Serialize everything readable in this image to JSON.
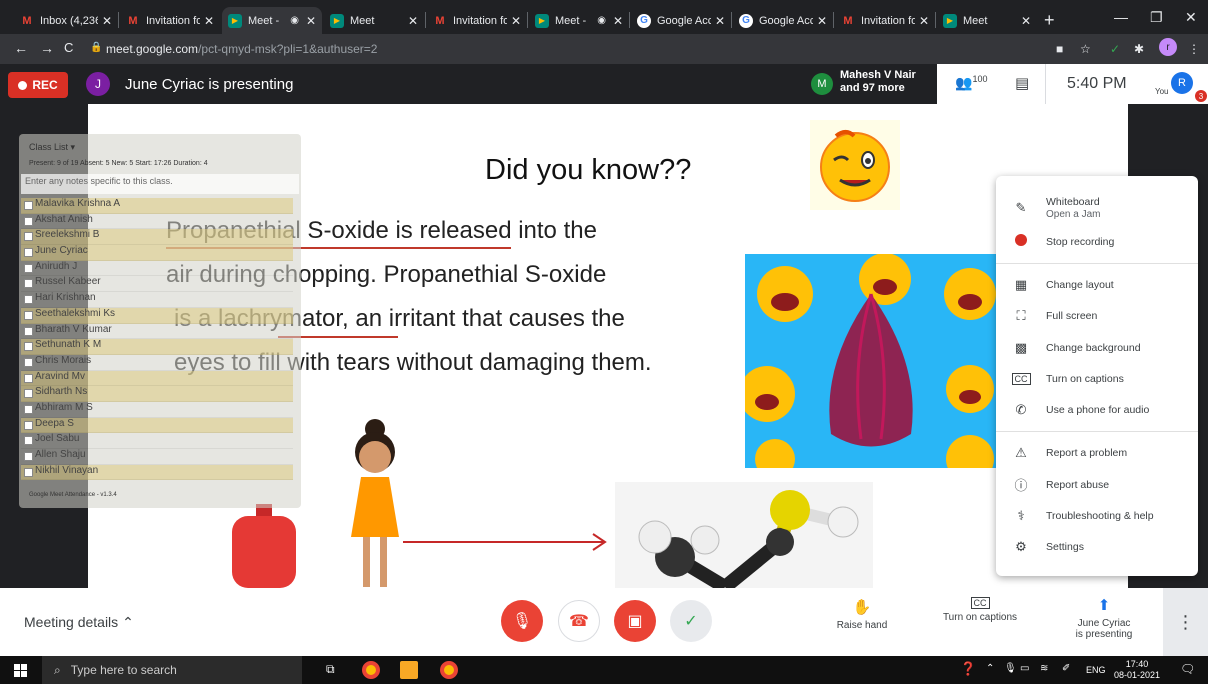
{
  "browser": {
    "tabs": [
      {
        "title": "Inbox (4,236",
        "icon": "gmail-icon",
        "active": false
      },
      {
        "title": "Invitation fo",
        "icon": "gmail-icon",
        "active": false
      },
      {
        "title": "Meet - ",
        "icon": "meet-icon",
        "active": true
      },
      {
        "title": "Meet",
        "icon": "meet-icon",
        "active": false
      },
      {
        "title": "Invitation fo",
        "icon": "gmail-icon",
        "active": false
      },
      {
        "title": "Meet - ",
        "icon": "meet-icon",
        "active": false
      },
      {
        "title": "Google Acco",
        "icon": "google-icon",
        "active": false
      },
      {
        "title": "Google Acco",
        "icon": "google-icon",
        "active": false
      },
      {
        "title": "Invitation fo",
        "icon": "gmail-icon",
        "active": false
      },
      {
        "title": "Meet",
        "icon": "meet-icon",
        "active": false
      }
    ],
    "url_host": "meet.google.com",
    "url_path": "/pct-qmyd-msk?pli=1&authuser=2",
    "profile_initial": "r"
  },
  "meet": {
    "rec_label": "REC",
    "presenter_initial": "J",
    "presenter_text": "June Cyriac is presenting",
    "speaker_initial": "M",
    "speaker_line1": "Mahesh V Nair",
    "speaker_line2": "and 97 more",
    "people_count": "100",
    "time": "5:40 PM",
    "you_label": "You",
    "user_initial": "R",
    "notification_count": "3"
  },
  "slide": {
    "title": "Did you know??",
    "lines": [
      "Propanethial S-oxide is released into the",
      "air during chopping. Propanethial S-oxide",
      "is a lachrymator, an irritant that causes the",
      "eyes to fill with tears without damaging them."
    ]
  },
  "attendance": {
    "title": "Class List",
    "stats": "Present: 9 of 19   Absent: 5   New: 5   Start: 17:26   Duration: 4",
    "note_placeholder": "Enter any notes specific to this class.",
    "students": [
      "Malavika Krishna A",
      "Akshat Anish",
      "Sreelekshmi B",
      "June Cyriac",
      "Anirudh J",
      "Russel Kabeer",
      "Hari Krishnan",
      "Seethalekshmi Ks",
      "Bharath V Kumar",
      "Sethunath K M",
      "Chris Morais",
      "Aravind Mv",
      "Sidharth Ns",
      "Abhiram M S",
      "Deepa S",
      "Joel Sabu",
      "Allen Shaju",
      "Nikhil Vinayan"
    ],
    "highlighted": [
      0,
      2,
      3,
      7,
      9,
      11,
      12,
      14,
      17
    ],
    "footer": "Google Meet Attendance - v1.3.4"
  },
  "menu": {
    "items": [
      {
        "label": "Whiteboard",
        "sub": "Open a Jam",
        "icon": "pen-icon"
      },
      {
        "label": "Stop recording",
        "icon": "record-icon"
      },
      {
        "label": "Change layout",
        "icon": "layout-icon"
      },
      {
        "label": "Full screen",
        "icon": "fullscreen-icon"
      },
      {
        "label": "Change background",
        "icon": "background-icon"
      },
      {
        "label": "Turn on captions",
        "icon": "captions-icon"
      },
      {
        "label": "Use a phone for audio",
        "icon": "phone-icon"
      },
      {
        "label": "Report a problem",
        "icon": "report-problem-icon"
      },
      {
        "label": "Report abuse",
        "icon": "report-abuse-icon"
      },
      {
        "label": "Troubleshooting & help",
        "icon": "troubleshoot-icon"
      },
      {
        "label": "Settings",
        "icon": "settings-icon"
      }
    ]
  },
  "bottom": {
    "meeting_details": "Meeting details",
    "raise_hand": "Raise hand",
    "captions": "Turn on captions",
    "presenting_line1": "June Cyriac",
    "presenting_line2": "is presenting"
  },
  "taskbar": {
    "search_placeholder": "Type here to search",
    "lang": "ENG",
    "time": "17:40",
    "date": "08-01-2021"
  },
  "colors": {
    "rec_red": "#d93025",
    "accent_blue": "#1a73e8",
    "end_call_red": "#ea4335",
    "check_green": "#34a853"
  }
}
